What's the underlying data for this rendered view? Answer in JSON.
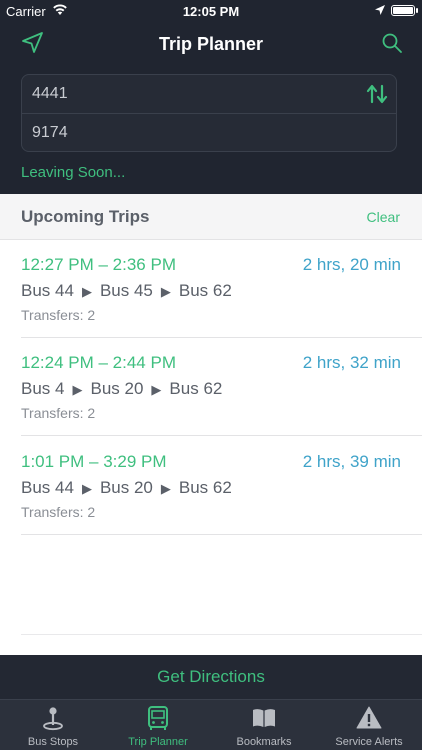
{
  "status_bar": {
    "carrier": "Carrier",
    "time": "12:05 PM"
  },
  "header": {
    "title": "Trip Planner",
    "from_value": "4441",
    "to_value": "9174",
    "leaving": "Leaving Soon..."
  },
  "section": {
    "title": "Upcoming Trips",
    "clear_label": "Clear"
  },
  "trips": [
    {
      "time": "12:27 PM – 2:36 PM",
      "duration": "2 hrs, 20 min",
      "buses": [
        "Bus 44",
        "Bus 45",
        "Bus 62"
      ],
      "transfers": "Transfers: 2"
    },
    {
      "time": "12:24 PM – 2:44 PM",
      "duration": "2 hrs, 32 min",
      "buses": [
        "Bus 4",
        "Bus 20",
        "Bus 62"
      ],
      "transfers": "Transfers: 2"
    },
    {
      "time": "1:01 PM – 3:29 PM",
      "duration": "2 hrs, 39 min",
      "buses": [
        "Bus 44",
        "Bus 20",
        "Bus 62"
      ],
      "transfers": "Transfers: 2"
    }
  ],
  "get_directions_label": "Get Directions",
  "tabs": [
    {
      "label": "Bus Stops",
      "icon": "map-pin-icon",
      "active": false
    },
    {
      "label": "Trip Planner",
      "icon": "bus-icon",
      "active": true
    },
    {
      "label": "Bookmarks",
      "icon": "book-icon",
      "active": false
    },
    {
      "label": "Service Alerts",
      "icon": "warning-icon",
      "active": false
    }
  ],
  "colors": {
    "accent": "#3fbf7f",
    "duration": "#3fa3c9",
    "header_bg": "#202530",
    "tab_bg": "#2c313c"
  }
}
